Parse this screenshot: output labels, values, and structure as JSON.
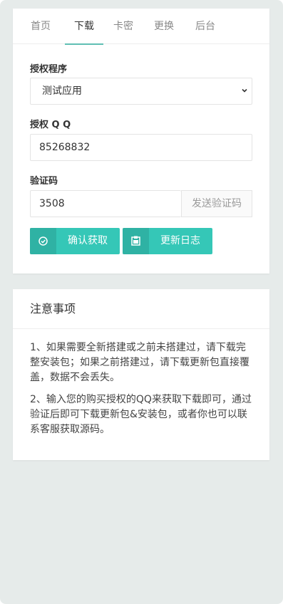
{
  "tabs": [
    "首页",
    "下载",
    "卡密",
    "更换",
    "后台"
  ],
  "form": {
    "program_label": "授权程序",
    "program_value": "测试应用",
    "qq_label": "授权 Q Q",
    "qq_value": "85268832",
    "code_label": "验证码",
    "code_value": "3508",
    "send_code": "发送验证码"
  },
  "buttons": {
    "confirm": "确认获取",
    "changelog": "更新日志"
  },
  "notice": {
    "title": "注意事项",
    "items": [
      "1、如果需要全新搭建或之前未搭建过，请下载完整安装包；如果之前搭建过，请下载更新包直接覆盖，数据不会丢失。",
      "2、输入您的购买授权的QQ来获取下载即可，通过验证后即可下载更新包&安装包，或者你也可以联系客服获取源码。"
    ]
  },
  "colors": {
    "accent": "#35c7b7",
    "tab_underline": "#5fbfb3",
    "background": "#e6ebea"
  },
  "icons": {
    "confirm": "check-circle-icon",
    "changelog": "clipboard-icon",
    "select": "chevron-down-icon"
  }
}
